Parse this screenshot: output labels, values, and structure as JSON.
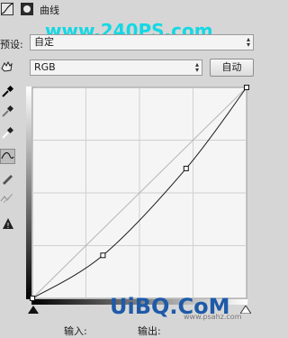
{
  "header": {
    "title": "曲线",
    "watermark": "www.240PS.com"
  },
  "preset": {
    "label": "预设:",
    "value": "自定"
  },
  "channel": {
    "value": "RGB",
    "auto_label": "自动"
  },
  "tools": [
    {
      "icon": "eyedropper-black-icon"
    },
    {
      "icon": "eyedropper-gray-icon"
    },
    {
      "icon": "eyedropper-white-icon"
    },
    {
      "icon": "curve-edit-icon"
    },
    {
      "icon": "pencil-icon"
    },
    {
      "icon": "smooth-icon"
    },
    {
      "icon": "clipping-warning-icon"
    }
  ],
  "footer": {
    "input_label": "输入:",
    "output_label": "输出:",
    "bottom_watermark": "UiBQ.CoM",
    "small_watermark": "www.psahz.com"
  },
  "curve": {
    "input_range": [
      0,
      255
    ],
    "points": [
      [
        0,
        0
      ],
      [
        84,
        52
      ],
      [
        183,
        157
      ],
      [
        255,
        255
      ]
    ],
    "colors": {
      "line": "#1a1a1a",
      "grid": "#d0d0d0",
      "baseline": "#b5b5b5"
    }
  }
}
